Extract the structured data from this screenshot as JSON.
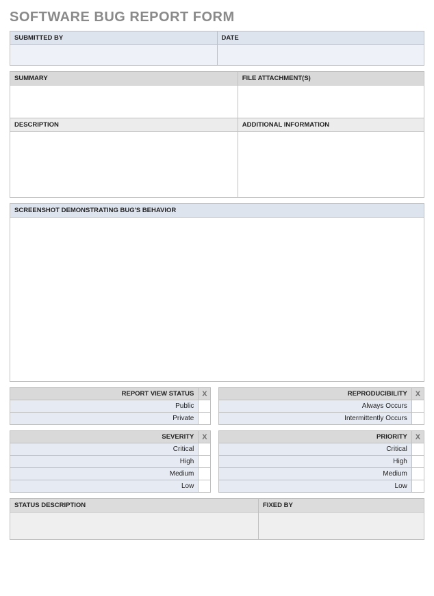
{
  "title": "SOFTWARE BUG REPORT FORM",
  "top": {
    "submitted_by": "SUBMITTED BY",
    "date": "DATE",
    "submitted_by_val": "",
    "date_val": ""
  },
  "detail": {
    "summary": "SUMMARY",
    "file_attachments": "FILE ATTACHMENT(S)",
    "description": "DESCRIPTION",
    "additional_info": "ADDITIONAL INFORMATION",
    "summary_val": "",
    "file_attachments_val": "",
    "description_val": "",
    "additional_info_val": ""
  },
  "screenshot": {
    "label": "SCREENSHOT DEMONSTRATING BUG'S BEHAVIOR",
    "value": ""
  },
  "viewstatus": {
    "header": "REPORT VIEW STATUS",
    "x": "X",
    "options": [
      "Public",
      "Private"
    ]
  },
  "reproducibility": {
    "header": "REPRODUCIBILITY",
    "x": "X",
    "options": [
      "Always Occurs",
      "Intermittently Occurs"
    ]
  },
  "severity": {
    "header": "SEVERITY",
    "x": "X",
    "options": [
      "Critical",
      "High",
      "Medium",
      "Low"
    ]
  },
  "priority": {
    "header": "PRIORITY",
    "x": "X",
    "options": [
      "Critical",
      "High",
      "Medium",
      "Low"
    ]
  },
  "status": {
    "description": "STATUS DESCRIPTION",
    "fixed_by": "FIXED BY",
    "description_val": "",
    "fixed_by_val": ""
  }
}
